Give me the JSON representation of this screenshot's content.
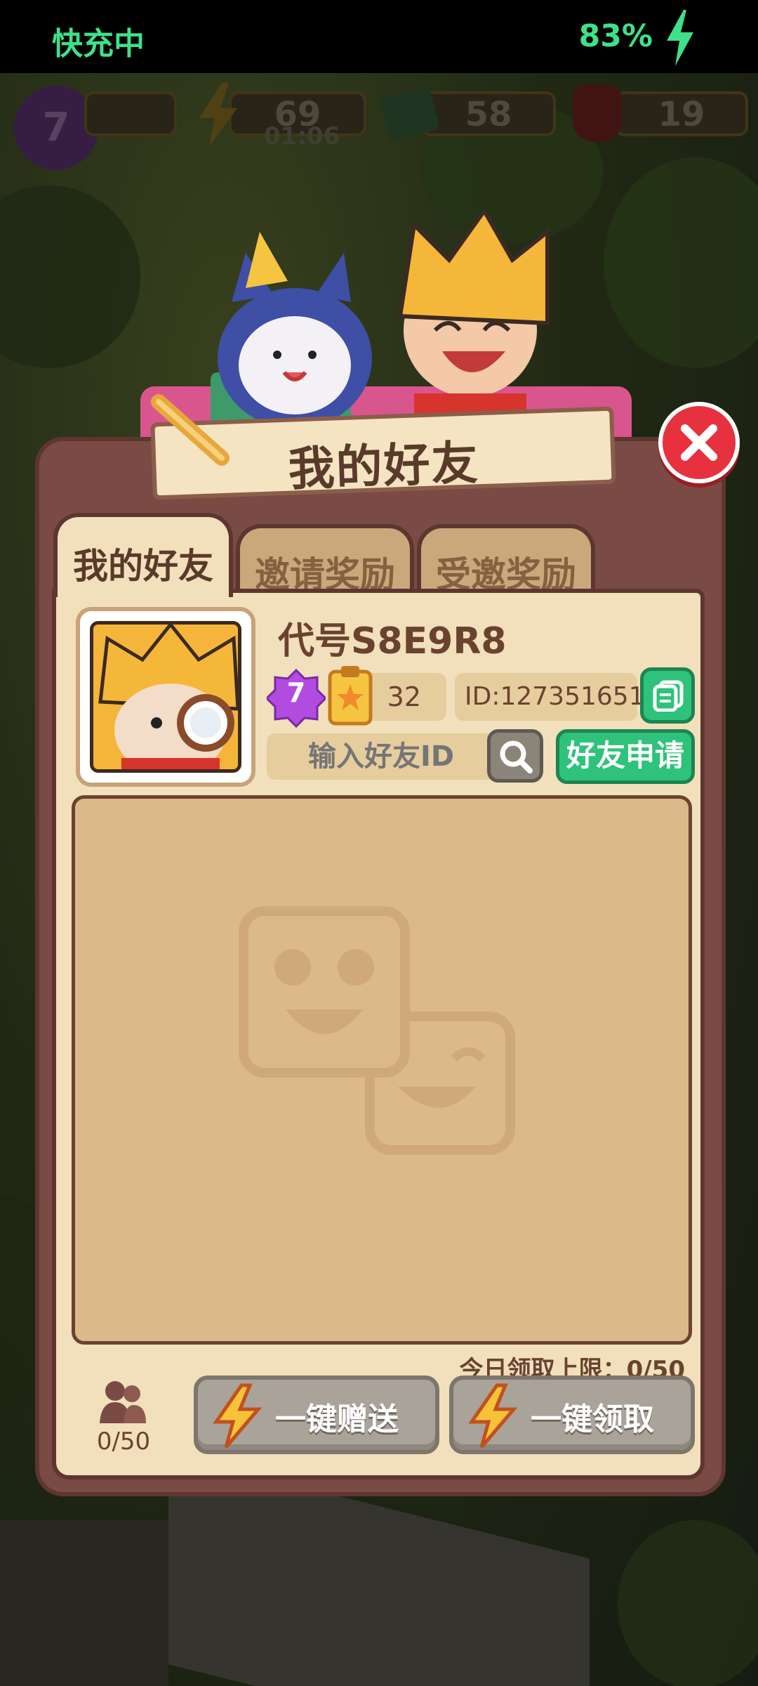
{
  "status_bar": {
    "left_text": "快充中",
    "battery_text": "83%"
  },
  "hud": {
    "level": "7",
    "energy": "69",
    "energy_timer": "01:06",
    "cash": "58",
    "gems": "19"
  },
  "dialog": {
    "title": "我的好友"
  },
  "tabs": [
    {
      "label": "我的好友",
      "active": true
    },
    {
      "label": "邀请奖励",
      "active": false
    },
    {
      "label": "受邀奖励",
      "active": false
    }
  ],
  "profile": {
    "name": "代号S8E9R8",
    "level": "7",
    "score": "32",
    "id": "ID:127351651"
  },
  "search": {
    "placeholder": "输入好友ID",
    "apply_label": "好友申请"
  },
  "footer": {
    "daily_limit": "今日领取上限：0/50",
    "friend_count": "0/50",
    "send_all_label": "一键赠送",
    "collect_all_label": "一键领取"
  },
  "colors": {
    "accent_green": "#2fc27a",
    "close_red": "#e8313f",
    "panel_brown": "#7a4b44",
    "cream": "#f1e0bb"
  }
}
